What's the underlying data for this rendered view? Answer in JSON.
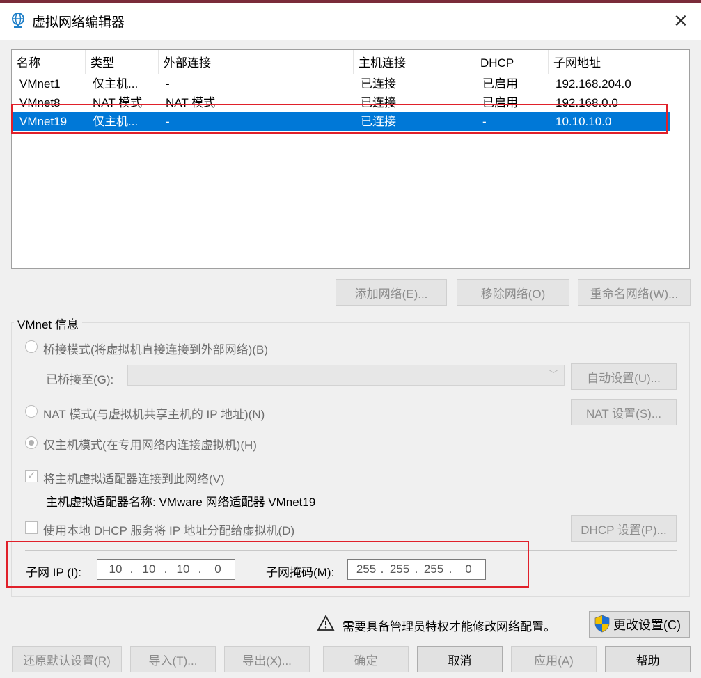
{
  "window": {
    "title": "虚拟网络编辑器",
    "close_symbol": "✕"
  },
  "networks": {
    "headers": [
      "名称",
      "类型",
      "外部连接",
      "主机连接",
      "DHCP",
      "子网地址"
    ],
    "rows": [
      [
        "VMnet1",
        "仅主机...",
        "-",
        "已连接",
        "已启用",
        "192.168.204.0"
      ],
      [
        "VMnet8",
        "NAT 模式",
        "NAT 模式",
        "已连接",
        "已启用",
        "192.168.0.0"
      ],
      [
        "VMnet19",
        "仅主机...",
        "-",
        "已连接",
        "-",
        "10.10.10.0"
      ]
    ],
    "selected_index": 2
  },
  "list_buttons": {
    "add": "添加网络(E)...",
    "remove": "移除网络(O)",
    "rename": "重命名网络(W)..."
  },
  "vmnet_info": {
    "title": "VMnet 信息",
    "bridged_label": "桥接模式(将虚拟机直接连接到外部网络)(B)",
    "bridged_to_label": "已桥接至(G):",
    "bridged_to_value": "",
    "auto_settings": "自动设置(U)...",
    "nat_label": "NAT 模式(与虚拟机共享主机的 IP 地址)(N)",
    "nat_settings": "NAT 设置(S)...",
    "hostonly_label": "仅主机模式(在专用网络内连接虚拟机)(H)",
    "connect_adapter_label": "将主机虚拟适配器连接到此网络(V)",
    "adapter_name_label": "主机虚拟适配器名称: VMware 网络适配器 VMnet19",
    "dhcp_label": "使用本地 DHCP 服务将 IP 地址分配给虚拟机(D)",
    "dhcp_settings": "DHCP 设置(P)...",
    "subnet_ip_label": "子网 IP (I):",
    "subnet_ip": [
      "10",
      "10",
      "10",
      "0"
    ],
    "subnet_mask_label": "子网掩码(M):",
    "subnet_mask": [
      "255",
      "255",
      "255",
      "0"
    ]
  },
  "admin": {
    "notice": "需要具备管理员特权才能修改网络配置。",
    "change_settings": "更改设置(C)"
  },
  "footer": {
    "restore": "还原默认设置(R)",
    "import": "导入(T)...",
    "export": "导出(X)...",
    "ok": "确定",
    "cancel": "取消",
    "apply": "应用(A)",
    "help": "帮助"
  },
  "colors": {
    "selection": "#0078d7",
    "highlight_box": "#e0202a"
  },
  "icons": {
    "app": "network-globe-icon",
    "warning": "warning-icon",
    "uac": "uac-shield-icon"
  }
}
